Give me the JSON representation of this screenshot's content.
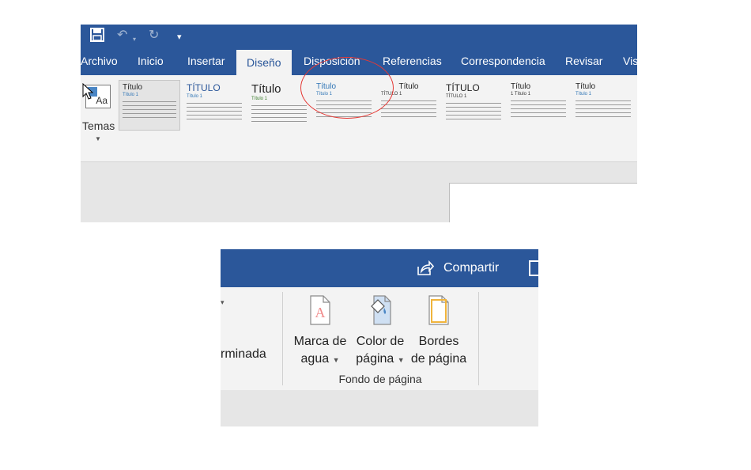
{
  "top_ribbon": {
    "quick_access": {
      "save_icon": "save-icon",
      "undo_icon": "undo-icon",
      "redo_icon": "redo-icon",
      "customize_icon": "customize-qat-icon"
    },
    "tabs": [
      "Archivo",
      "Inicio",
      "Insertar",
      "Diseño",
      "Disposición",
      "Referencias",
      "Correspondencia",
      "Revisar",
      "Vist"
    ],
    "active_tab": "Diseño",
    "themes_button": {
      "label": "Temas",
      "icon": "themes-icon"
    },
    "style_gallery": [
      {
        "title": "Título",
        "subtitle": "Título 1"
      },
      {
        "title": "TÍTULO",
        "subtitle": "Título 1"
      },
      {
        "title": "Título",
        "subtitle": "Título 1"
      },
      {
        "title": "Título",
        "subtitle": "Título 1"
      },
      {
        "title": "Título",
        "subtitle": "TÍTULO 1"
      },
      {
        "title": "TÍTULO",
        "subtitle": "TÍTULO 1"
      },
      {
        "title": "Título",
        "subtitle": "1  Título 1"
      },
      {
        "title": "Título",
        "subtitle": "Título 1"
      }
    ]
  },
  "right_ribbon": {
    "share": {
      "label": "Compartir",
      "icon": "share-icon"
    },
    "comment_icon": "comment-icon",
    "previous_group_text": "rminada",
    "page_background_group": {
      "label": "Fondo de página",
      "watermark": {
        "line1": "Marca de",
        "line2": "agua",
        "icon": "watermark-icon"
      },
      "page_color": {
        "line1": "Color de",
        "line2": "página",
        "icon": "page-color-icon"
      },
      "page_borders": {
        "line1": "Bordes",
        "line2": "de página",
        "icon": "page-borders-icon"
      }
    }
  },
  "colors": {
    "brand_blue": "#2b579a",
    "ribbon_bg": "#f3f3f3",
    "highlight_red": "#e53935"
  }
}
